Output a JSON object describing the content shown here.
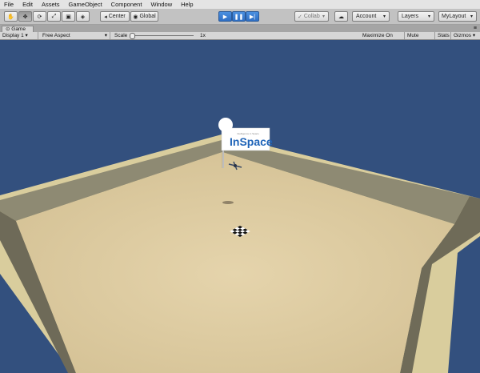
{
  "menu": [
    "File",
    "Edit",
    "Assets",
    "GameObject",
    "Component",
    "Window",
    "Help"
  ],
  "toolbar": {
    "pivot_label": "Center",
    "space_label": "Global",
    "collab_label": "Collab",
    "account_label": "Account",
    "layers_label": "Layers",
    "layout_label": "MyLayout"
  },
  "tab": {
    "title": "Game"
  },
  "gamebar": {
    "display": "Display 1",
    "aspect": "Free Aspect",
    "scale_label": "Scale",
    "scale_value": "1x",
    "maximize": "Maximize On Play",
    "mute": "Mute Audio",
    "stats": "Stats",
    "gizmos": "Gizmos"
  },
  "scene": {
    "sign_text": "InSpace",
    "sign_tagline": "Intelligence in Space",
    "colors": {
      "sky": "#33507e",
      "floor": "#dcc99e",
      "wall": "#8f8a74",
      "accent": "#2f6fc4"
    }
  }
}
